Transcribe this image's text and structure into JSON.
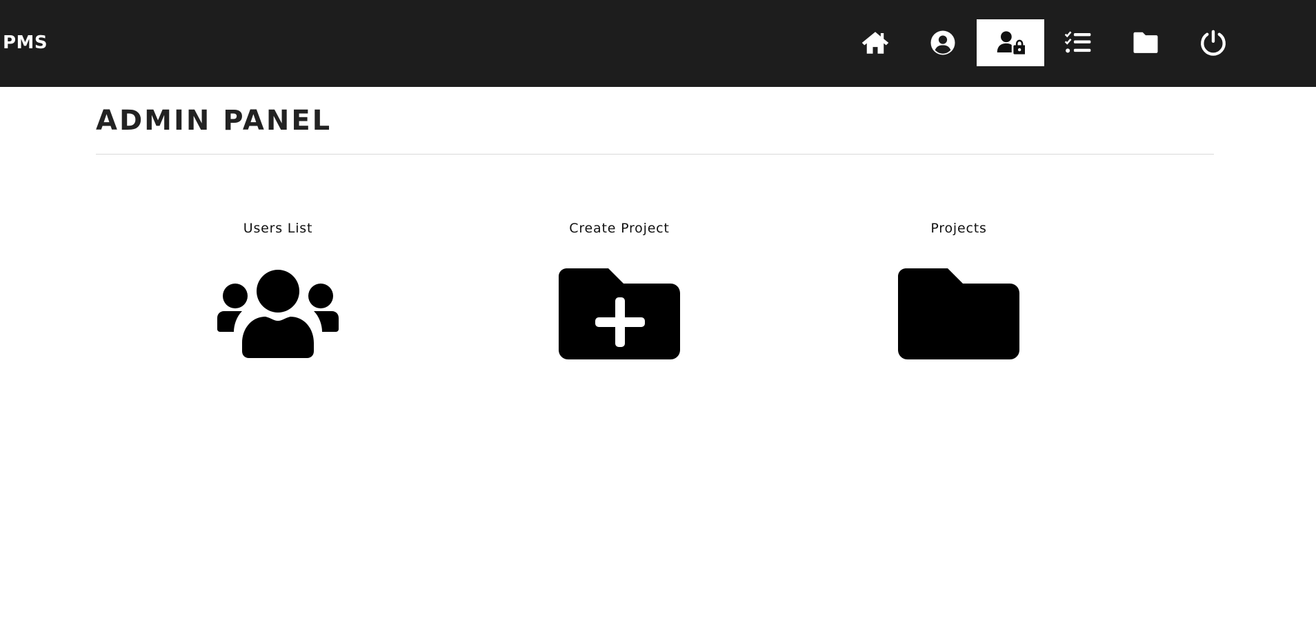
{
  "app": {
    "brand": "PMS"
  },
  "nav": {
    "items": [
      {
        "icon": "home-icon",
        "active": false
      },
      {
        "icon": "user-circle-icon",
        "active": false
      },
      {
        "icon": "user-lock-icon",
        "active": true
      },
      {
        "icon": "task-list-icon",
        "active": false
      },
      {
        "icon": "folder-icon",
        "active": false
      },
      {
        "icon": "power-icon",
        "active": false
      }
    ]
  },
  "page": {
    "title": "ADMIN PANEL"
  },
  "cards": [
    {
      "label": "Users List",
      "icon": "users-icon"
    },
    {
      "label": "Create Project",
      "icon": "folder-plus-icon"
    },
    {
      "label": "Projects",
      "icon": "folder-icon"
    }
  ],
  "colors": {
    "navbar_bg": "#1d1d1d",
    "nav_icon": "#ffffff",
    "nav_active_bg": "#ffffff",
    "nav_active_icon": "#111111",
    "card_icon": "#000000"
  }
}
